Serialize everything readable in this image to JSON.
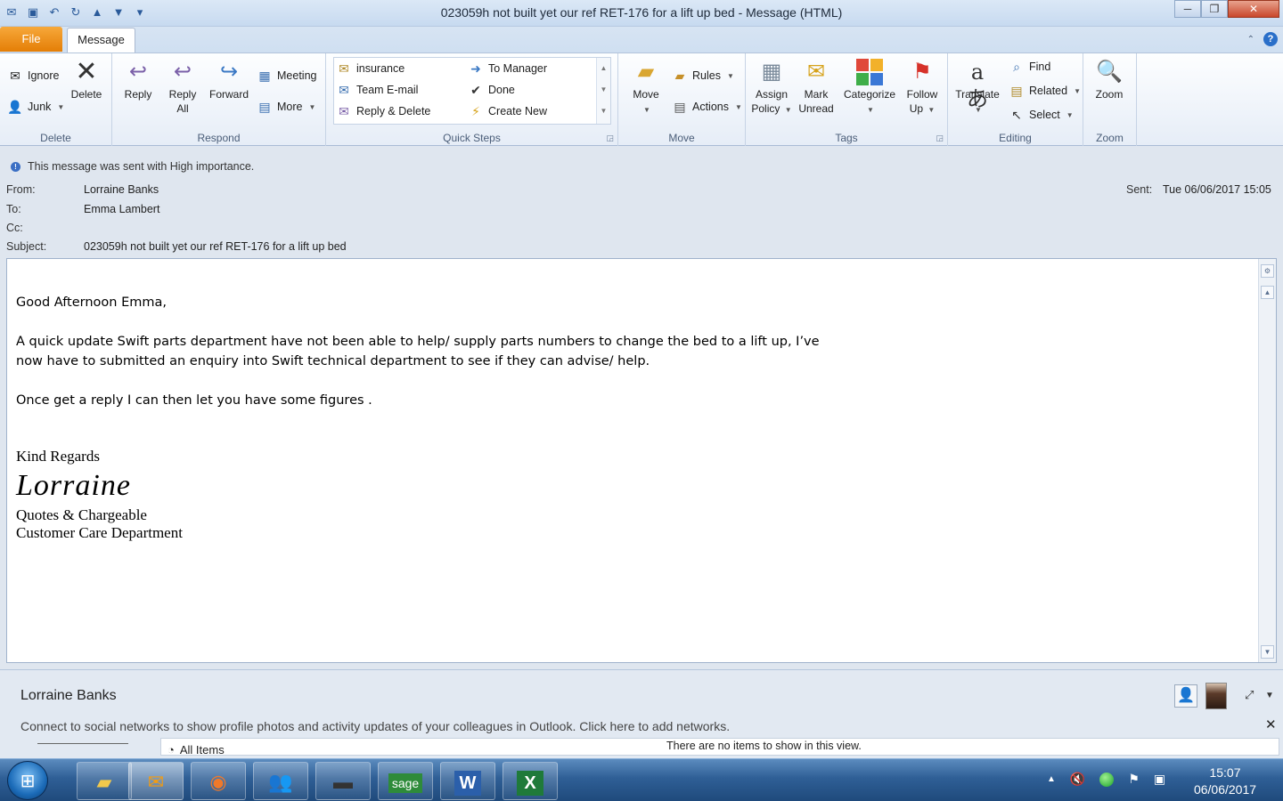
{
  "window": {
    "title": "023059h not built yet  our ref RET-176 for a lift up bed  -  Message (HTML)"
  },
  "tabs": {
    "file": "File",
    "message": "Message"
  },
  "ribbon": {
    "delete_group": {
      "label": "Delete",
      "ignore": "Ignore",
      "junk": "Junk",
      "delete": "Delete"
    },
    "respond_group": {
      "label": "Respond",
      "reply": "Reply",
      "reply_all_1": "Reply",
      "reply_all_2": "All",
      "forward": "Forward",
      "meeting": "Meeting",
      "more": "More"
    },
    "quick_steps": {
      "label": "Quick Steps",
      "items": [
        "insurance",
        "Team E-mail",
        "Reply & Delete",
        "To Manager",
        "Done",
        "Create New"
      ]
    },
    "move_group": {
      "label": "Move",
      "move": "Move",
      "rules": "Rules",
      "actions": "Actions"
    },
    "tags_group": {
      "label": "Tags",
      "assign_policy_1": "Assign",
      "assign_policy_2": "Policy",
      "mark_unread_1": "Mark",
      "mark_unread_2": "Unread",
      "categorize": "Categorize",
      "follow_up_1": "Follow",
      "follow_up_2": "Up"
    },
    "editing_group": {
      "label": "Editing",
      "translate": "Translate",
      "find": "Find",
      "related": "Related",
      "select": "Select"
    },
    "zoom_group": {
      "label": "Zoom",
      "zoom": "Zoom"
    }
  },
  "header": {
    "importance": "This message was sent with High importance.",
    "from_label": "From:",
    "from": "Lorraine Banks",
    "to_label": "To:",
    "to": "Emma Lambert",
    "cc_label": "Cc:",
    "cc": "",
    "subject_label": "Subject:",
    "subject": "023059h not built yet  our ref RET-176 for a lift up bed",
    "sent_label": "Sent:",
    "sent": "Tue 06/06/2017 15:05"
  },
  "message": {
    "greeting": "Good Afternoon Emma,",
    "para1_line1": "A quick update Swift parts department have not  been able to help/ supply parts numbers to change the bed to a lift up,  I’ve",
    "para1_line2": "now have to submitted an enquiry into Swift technical  department to see if they can advise/ help.",
    "para2": "Once get a reply I can then let you have some figures .",
    "sig_regards": "Kind Regards",
    "sig_name": "Lorraine",
    "sig_line1": "Quotes & Chargeable",
    "sig_line2": "Customer Care Department"
  },
  "people_pane": {
    "name": "Lorraine Banks",
    "connect_msg": "Connect to social networks to show profile photos and activity updates of your colleagues in Outlook. Click here to add networks.",
    "all_items": "All Items",
    "no_items": "There are no items to show in this view."
  },
  "taskbar": {
    "time": "15:07",
    "date": "06/06/2017",
    "apps": [
      "explorer-icon",
      "outlook-icon",
      "firefox-icon",
      "users-icon",
      "stapler-icon",
      "sage-icon",
      "word-icon",
      "excel-icon"
    ]
  }
}
